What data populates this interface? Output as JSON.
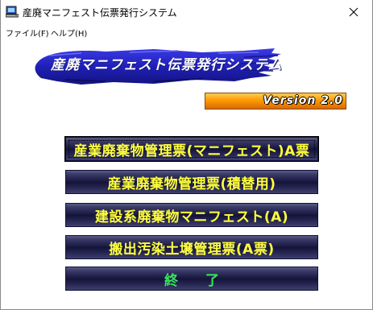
{
  "window": {
    "title": "産廃マニフェスト伝票発行システム"
  },
  "menubar": {
    "items": [
      "ファイル(F)",
      "ヘルプ(H)"
    ]
  },
  "banner": {
    "title": "産廃マニフェスト伝票発行システム"
  },
  "version": {
    "label": "Version 2.0"
  },
  "buttons": [
    {
      "label": "産業廃棄物管理票(マニフェスト)A票"
    },
    {
      "label": "産業廃棄物管理票(積替用)"
    },
    {
      "label": "建設系廃棄物マニフェスト(A)"
    },
    {
      "label": "搬出汚染土壌管理票(A票)"
    },
    {
      "label": "終　　了"
    }
  ],
  "colors": {
    "button_text": "#ffff3c",
    "exit_text": "#36e85a",
    "banner_blue": "#2b2bd8",
    "version_orange": "#ff9a00"
  },
  "icons": {
    "app": "computer-terminal-icon",
    "close": "close-icon"
  }
}
